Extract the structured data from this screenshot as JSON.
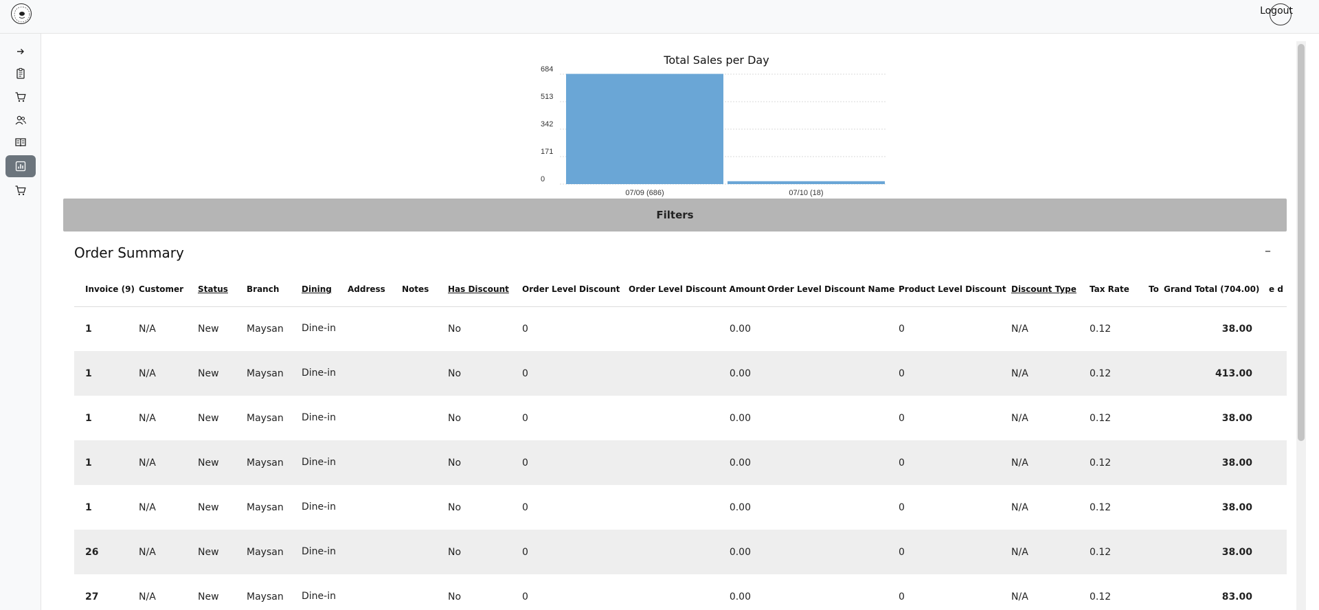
{
  "header": {
    "logout_label": "Logout"
  },
  "sidebar": {
    "items": [
      {
        "icon": "arrow-right-icon",
        "active": false
      },
      {
        "icon": "orders-list-icon",
        "active": false
      },
      {
        "icon": "cart-icon",
        "active": false
      },
      {
        "icon": "users-icon",
        "active": false
      },
      {
        "icon": "book-icon",
        "active": false
      },
      {
        "icon": "report-chart-icon",
        "active": true
      },
      {
        "icon": "cart-icon",
        "active": false
      }
    ]
  },
  "chart_data": {
    "type": "bar",
    "title": "Total Sales per Day",
    "categories": [
      "07/09 (686)",
      "07/10 (18)"
    ],
    "values": [
      686,
      18
    ],
    "yticks": [
      "0",
      "171",
      "342",
      "513",
      "684"
    ],
    "ylim": [
      0,
      684
    ],
    "grid": true,
    "color": "#6aa6d6"
  },
  "filters": {
    "label": "Filters"
  },
  "summary": {
    "title": "Order Summary",
    "collapse_label": "–",
    "columns": [
      "Invoice (9)",
      "Customer",
      "Status",
      "Branch",
      "Dining",
      "Address",
      "Notes",
      "Has Discount",
      "Order Level Discount",
      "Order Level Discount Amount",
      "Order Level Discount Name",
      "Product Level Discount",
      "Discount Type",
      "Tax Rate",
      "To",
      "Grand Total (704.00)",
      "e d"
    ],
    "rows": [
      [
        "1",
        "N/A",
        "New",
        "Maysan",
        "Dine-in",
        "",
        "",
        "No",
        "0",
        "0.00",
        "",
        "0",
        "N/A",
        "0.12",
        "",
        "38.00",
        ""
      ],
      [
        "1",
        "N/A",
        "New",
        "Maysan",
        "Dine-in",
        "",
        "",
        "No",
        "0",
        "0.00",
        "",
        "0",
        "N/A",
        "0.12",
        "",
        "413.00",
        ""
      ],
      [
        "1",
        "N/A",
        "New",
        "Maysan",
        "Dine-in",
        "",
        "",
        "No",
        "0",
        "0.00",
        "",
        "0",
        "N/A",
        "0.12",
        "",
        "38.00",
        ""
      ],
      [
        "1",
        "N/A",
        "New",
        "Maysan",
        "Dine-in",
        "",
        "",
        "No",
        "0",
        "0.00",
        "",
        "0",
        "N/A",
        "0.12",
        "",
        "38.00",
        ""
      ],
      [
        "1",
        "N/A",
        "New",
        "Maysan",
        "Dine-in",
        "",
        "",
        "No",
        "0",
        "0.00",
        "",
        "0",
        "N/A",
        "0.12",
        "",
        "38.00",
        ""
      ],
      [
        "26",
        "N/A",
        "New",
        "Maysan",
        "Dine-in",
        "",
        "",
        "No",
        "0",
        "0.00",
        "",
        "0",
        "N/A",
        "0.12",
        "",
        "38.00",
        ""
      ],
      [
        "27",
        "N/A",
        "New",
        "Maysan",
        "Dine-in",
        "",
        "",
        "No",
        "0",
        "0.00",
        "",
        "0",
        "N/A",
        "0.12",
        "",
        "83.00",
        ""
      ]
    ]
  }
}
